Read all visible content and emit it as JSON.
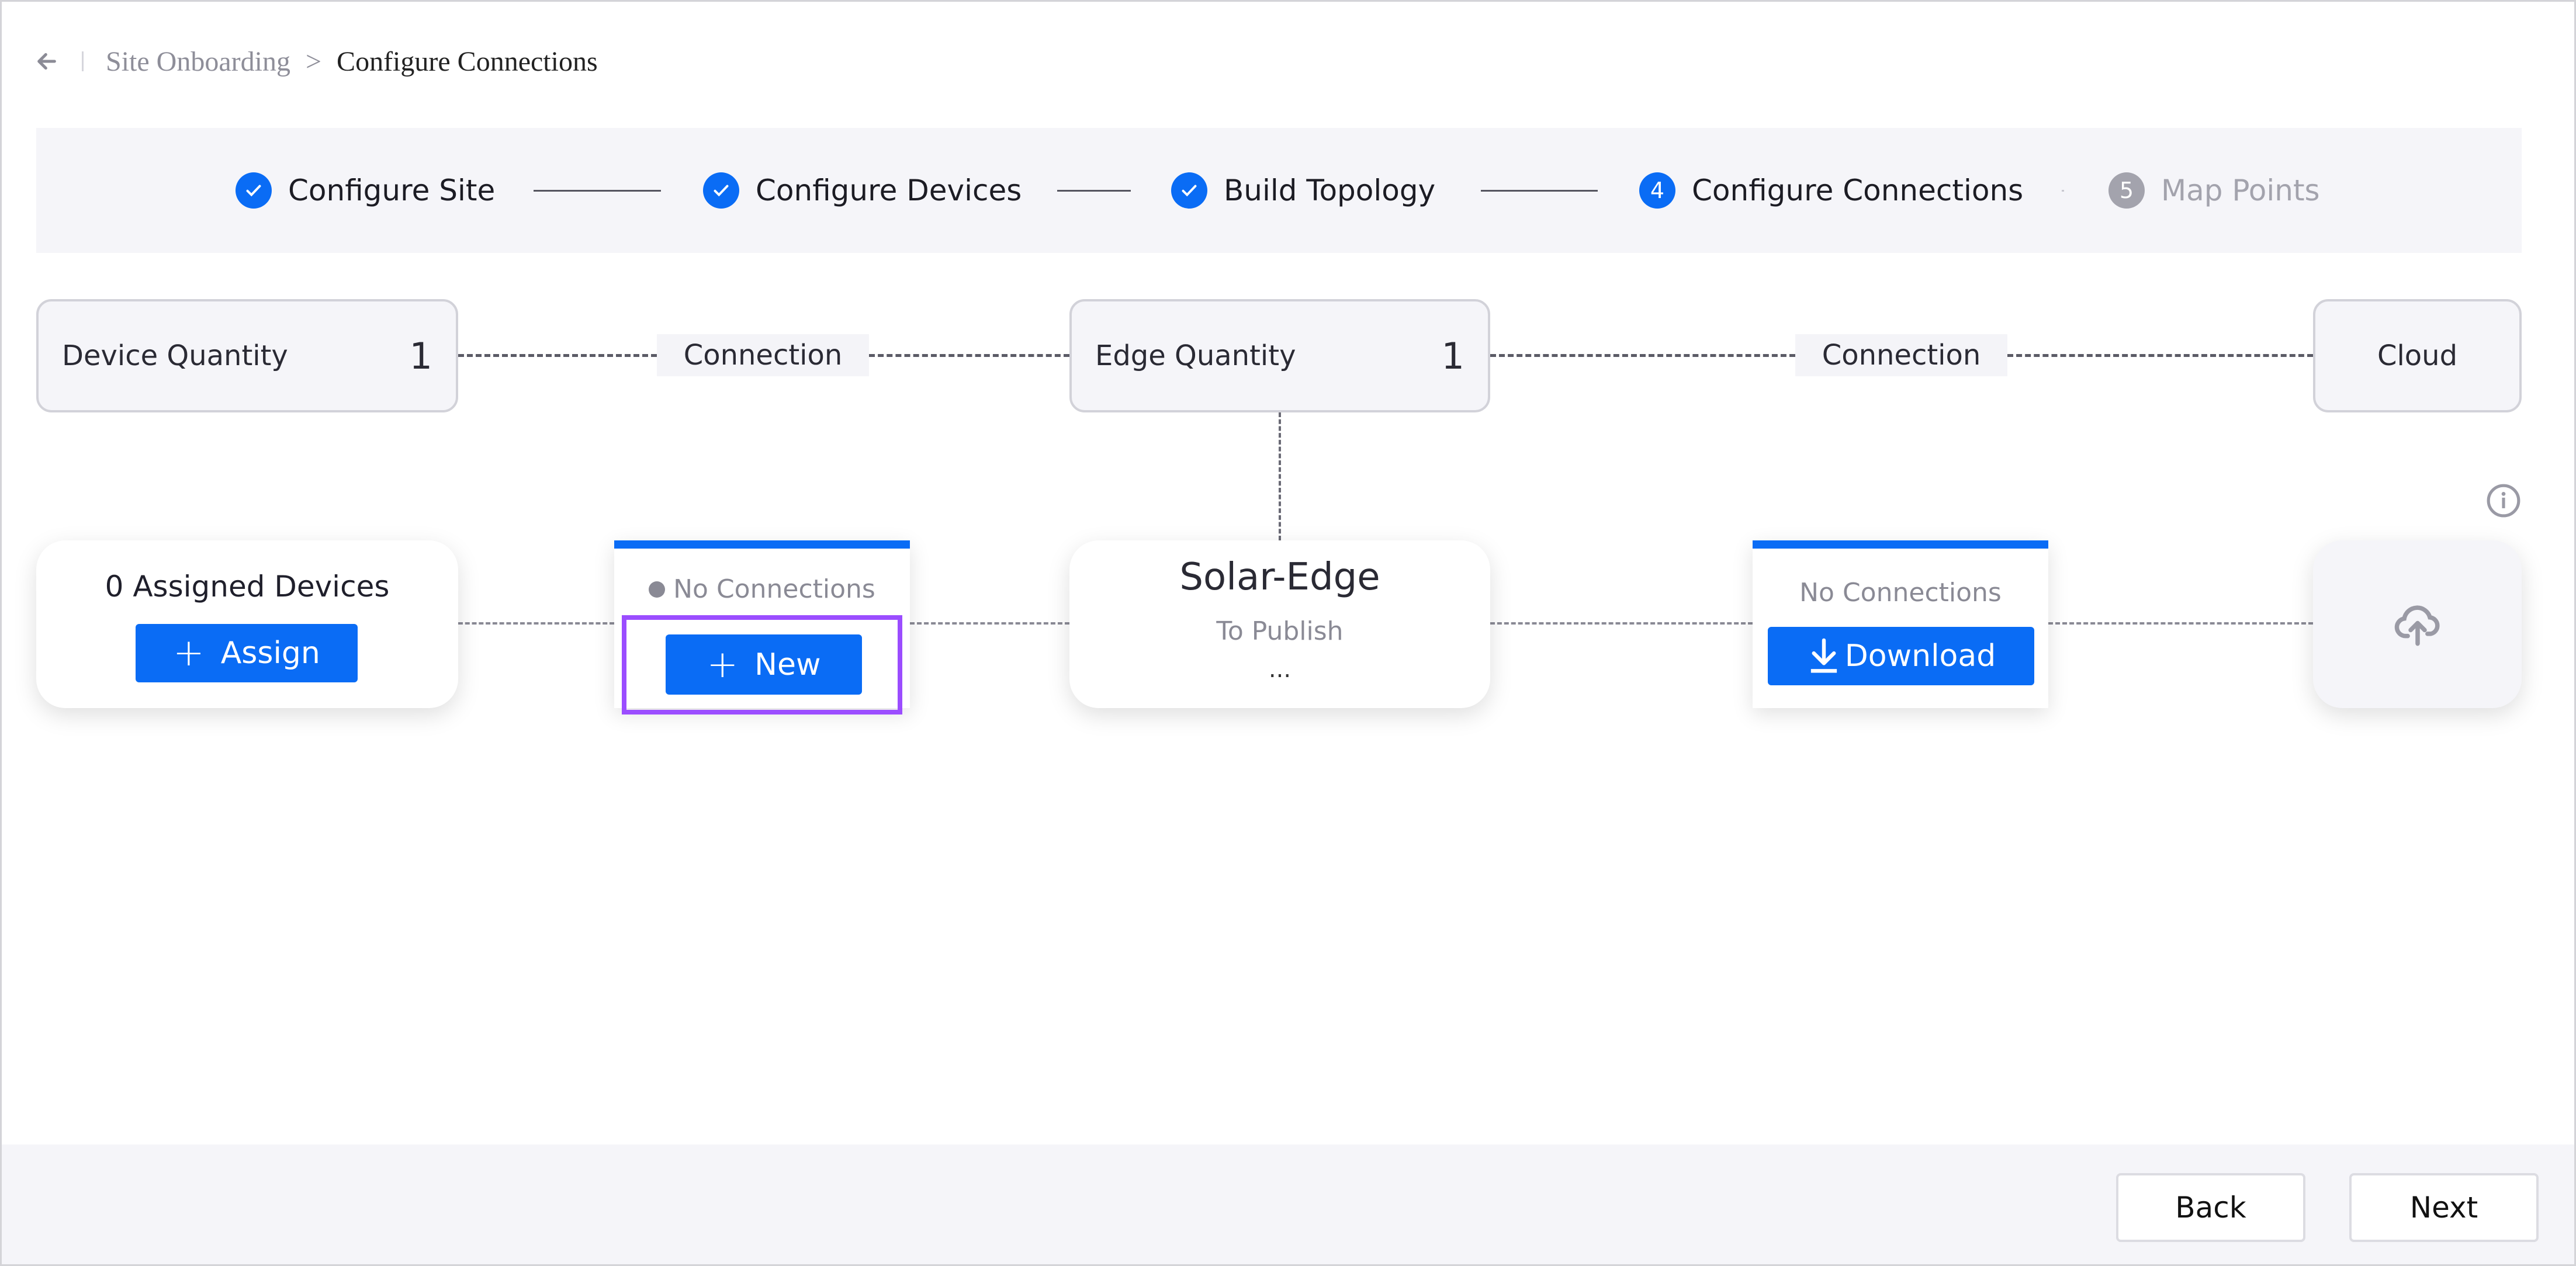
{
  "breadcrumb": {
    "back_icon": "arrow-left-icon",
    "parent": "Site Onboarding",
    "separator": ">",
    "current": "Configure Connections"
  },
  "stepper": {
    "steps": [
      {
        "label": "Configure Site",
        "status": "done",
        "icon": "check-icon"
      },
      {
        "label": "Configure Devices",
        "status": "done",
        "icon": "check-icon"
      },
      {
        "label": "Build Topology",
        "status": "done",
        "icon": "check-icon"
      },
      {
        "label": "Configure Connections",
        "status": "active",
        "number": "4"
      },
      {
        "label": "Map Points",
        "status": "pending",
        "number": "5"
      }
    ]
  },
  "topology": {
    "device_quantity": {
      "label": "Device Quantity",
      "value": "1"
    },
    "connection_label_1": "Connection",
    "edge_quantity": {
      "label": "Edge Quantity",
      "value": "1"
    },
    "connection_label_2": "Connection",
    "cloud_label": "Cloud",
    "assigned_card": {
      "title": "0 Assigned Devices",
      "button": "Assign",
      "button_icon": "plus-icon"
    },
    "device_connection_card": {
      "status": "No Connections",
      "status_icon": "status-dot-icon",
      "button": "New",
      "button_icon": "plus-icon"
    },
    "edge_card": {
      "name": "Solar-Edge",
      "status": "To Publish",
      "more": "..."
    },
    "cloud_connection_card": {
      "status": "No Connections",
      "button": "Download",
      "button_icon": "download-icon"
    },
    "cloud_card": {
      "icon": "cloud-upload-icon"
    },
    "info_icon": "info-icon"
  },
  "footer": {
    "back_label": "Back",
    "next_label": "Next"
  },
  "colors": {
    "accent": "#0a6cf5",
    "highlight": "#9b4dff",
    "pending": "#a3a3ad"
  }
}
